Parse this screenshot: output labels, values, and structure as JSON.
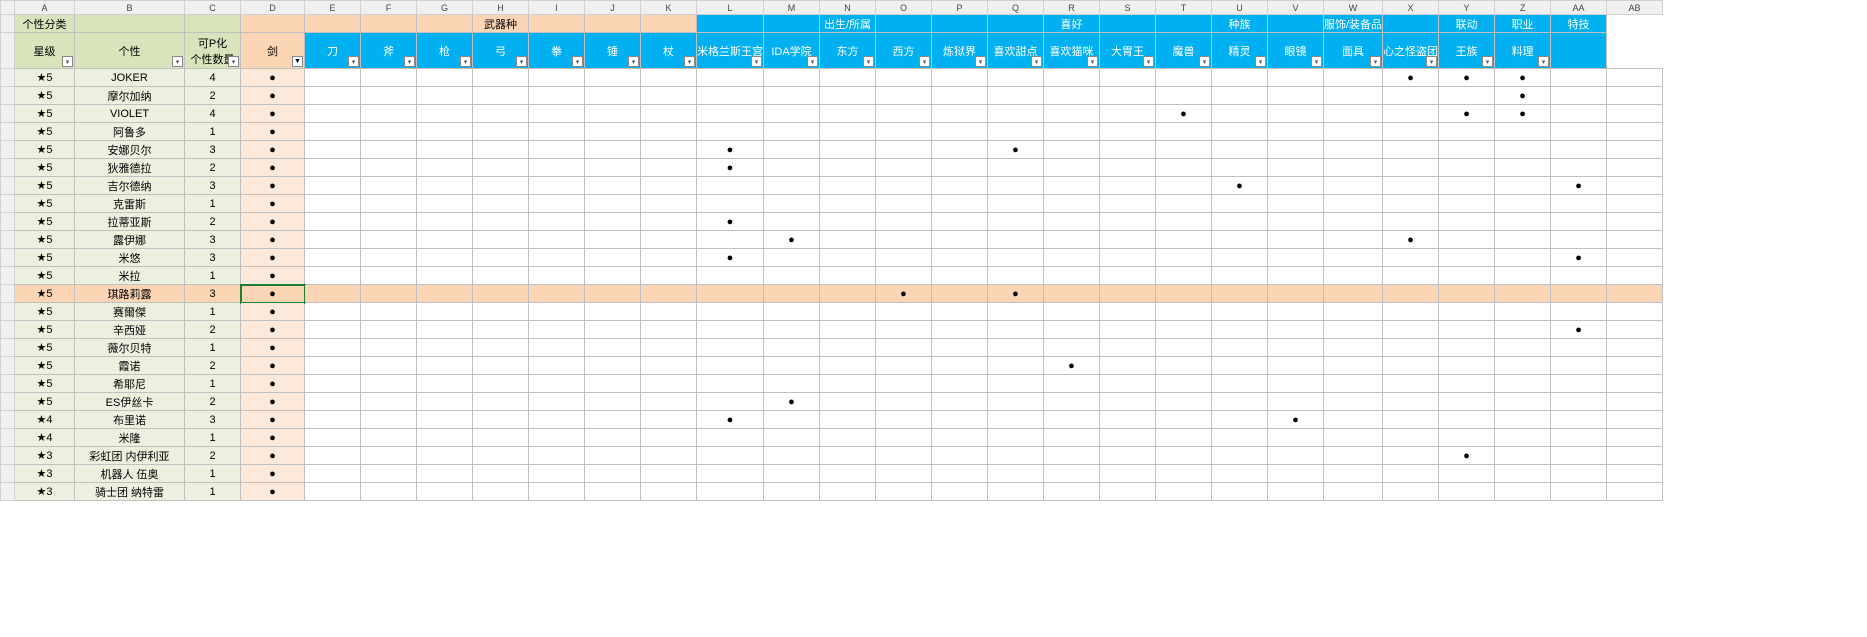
{
  "colLetters": [
    "",
    "A",
    "B",
    "C",
    "D",
    "E",
    "F",
    "G",
    "H",
    "I",
    "J",
    "K",
    "L",
    "M",
    "N",
    "O",
    "P",
    "Q",
    "R",
    "S",
    "T",
    "U",
    "V",
    "W",
    "X",
    "Y",
    "Z",
    "AA",
    "AB"
  ],
  "group1": {
    "label": "个性分类",
    "cols": [
      "星级",
      "个性",
      "可P化\n个性数量"
    ]
  },
  "group2": {
    "label": "武器种",
    "cols": [
      "剑",
      "刀",
      "斧",
      "枪",
      "弓",
      "拳",
      "锤",
      "杖"
    ]
  },
  "group3": {
    "label": "出生/所属",
    "cols": [
      "米格兰斯王宫",
      "IDA学院",
      "东方",
      "西方",
      "炼狱界"
    ]
  },
  "group4": {
    "label": "喜好",
    "cols": [
      "喜欢甜点",
      "喜欢猫咪",
      "大胃王"
    ]
  },
  "group5": {
    "label": "种族",
    "cols": [
      "魔兽",
      "精灵"
    ]
  },
  "group6": {
    "label": "服饰/装备品",
    "cols": [
      "眼镜",
      "面具",
      "心之怪盗团"
    ]
  },
  "group7": {
    "label": "联动",
    "cols": [
      "王族"
    ]
  },
  "group8": {
    "label": "职业",
    "cols": [
      "料理"
    ]
  },
  "group9": {
    "label": "特技",
    "cols": []
  },
  "rows": [
    {
      "star": "★5",
      "name": "JOKER",
      "p": "4",
      "dots": {
        "0": 1,
        "20": 1,
        "21": 1,
        "22": 1
      }
    },
    {
      "star": "★5",
      "name": "摩尔加纳",
      "p": "2",
      "dots": {
        "0": 1,
        "22": 1
      }
    },
    {
      "star": "★5",
      "name": "VIOLET",
      "p": "4",
      "dots": {
        "0": 1,
        "16": 1,
        "21": 1,
        "22": 1
      }
    },
    {
      "star": "★5",
      "name": "阿鲁多",
      "p": "1",
      "dots": {
        "0": 1
      }
    },
    {
      "star": "★5",
      "name": "安娜贝尔",
      "p": "3",
      "dots": {
        "0": 1,
        "8": 1,
        "13": 1
      }
    },
    {
      "star": "★5",
      "name": "狄雅德拉",
      "p": "2",
      "dots": {
        "0": 1,
        "8": 1
      }
    },
    {
      "star": "★5",
      "name": "吉尔德纳",
      "p": "3",
      "dots": {
        "0": 1,
        "17": 1,
        "23": 1
      }
    },
    {
      "star": "★5",
      "name": "克雷斯",
      "p": "1",
      "dots": {
        "0": 1
      }
    },
    {
      "star": "★5",
      "name": "拉蒂亚斯",
      "p": "2",
      "dots": {
        "0": 1,
        "8": 1
      }
    },
    {
      "star": "★5",
      "name": "露伊娜",
      "p": "3",
      "dots": {
        "0": 1,
        "9": 1,
        "20": 1
      }
    },
    {
      "star": "★5",
      "name": "米悠",
      "p": "3",
      "dots": {
        "0": 1,
        "8": 1,
        "23": 1
      }
    },
    {
      "star": "★5",
      "name": "米拉",
      "p": "1",
      "dots": {
        "0": 1
      }
    },
    {
      "star": "★5",
      "name": "琪路莉露",
      "p": "3",
      "dots": {
        "0": 1,
        "11": 1,
        "13": 1
      },
      "selected": true
    },
    {
      "star": "★5",
      "name": "赛爾傑",
      "p": "1",
      "dots": {
        "0": 1
      }
    },
    {
      "star": "★5",
      "name": "辛西娅",
      "p": "2",
      "dots": {
        "0": 1,
        "23": 1
      }
    },
    {
      "star": "★5",
      "name": "薇尔贝特",
      "p": "1",
      "dots": {
        "0": 1
      }
    },
    {
      "star": "★5",
      "name": "霞诺",
      "p": "2",
      "dots": {
        "0": 1,
        "14": 1
      }
    },
    {
      "star": "★5",
      "name": "希耶尼",
      "p": "1",
      "dots": {
        "0": 1
      }
    },
    {
      "star": "★5",
      "name": "ES伊丝卡",
      "p": "2",
      "dots": {
        "0": 1,
        "9": 1
      }
    },
    {
      "star": "★4",
      "name": "布里诺",
      "p": "3",
      "dots": {
        "0": 1,
        "8": 1,
        "18": 1
      }
    },
    {
      "star": "★4",
      "name": "米隆",
      "p": "1",
      "dots": {
        "0": 1
      }
    },
    {
      "star": "★3",
      "name": "彩虹团 内伊利亚",
      "p": "2",
      "dots": {
        "0": 1,
        "21": 1
      }
    },
    {
      "star": "★3",
      "name": "机器人 伍奥",
      "p": "1",
      "dots": {
        "0": 1
      }
    },
    {
      "star": "★3",
      "name": "骑士团 纳特雷",
      "p": "1",
      "dots": {
        "0": 1
      }
    }
  ],
  "dataColCount": 25
}
